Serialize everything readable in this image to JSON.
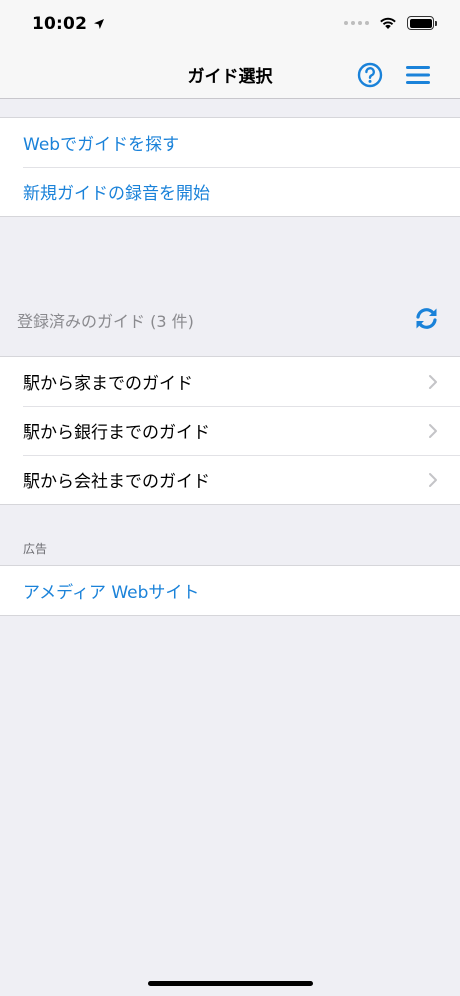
{
  "status_bar": {
    "time": "10:02",
    "icons": [
      "location-arrow-icon",
      "cellular-signal-icon",
      "wifi-icon",
      "battery-icon"
    ]
  },
  "nav": {
    "title": "ガイド選択",
    "help_icon": "question-circle-icon",
    "menu_icon": "hamburger-menu-icon",
    "accent_color": "#1a82d9"
  },
  "actions": {
    "items": [
      {
        "label": "Webでガイドを探す"
      },
      {
        "label": "新規ガイドの録音を開始"
      }
    ]
  },
  "registered": {
    "header": "登録済みのガイド (3 件)",
    "refresh_icon": "refresh-icon",
    "items": [
      {
        "label": "駅から家までのガイド"
      },
      {
        "label": "駅から銀行までのガイド"
      },
      {
        "label": "駅から会社までのガイド"
      }
    ]
  },
  "ads": {
    "header": "広告",
    "items": [
      {
        "label": "アメディア Webサイト"
      }
    ]
  }
}
